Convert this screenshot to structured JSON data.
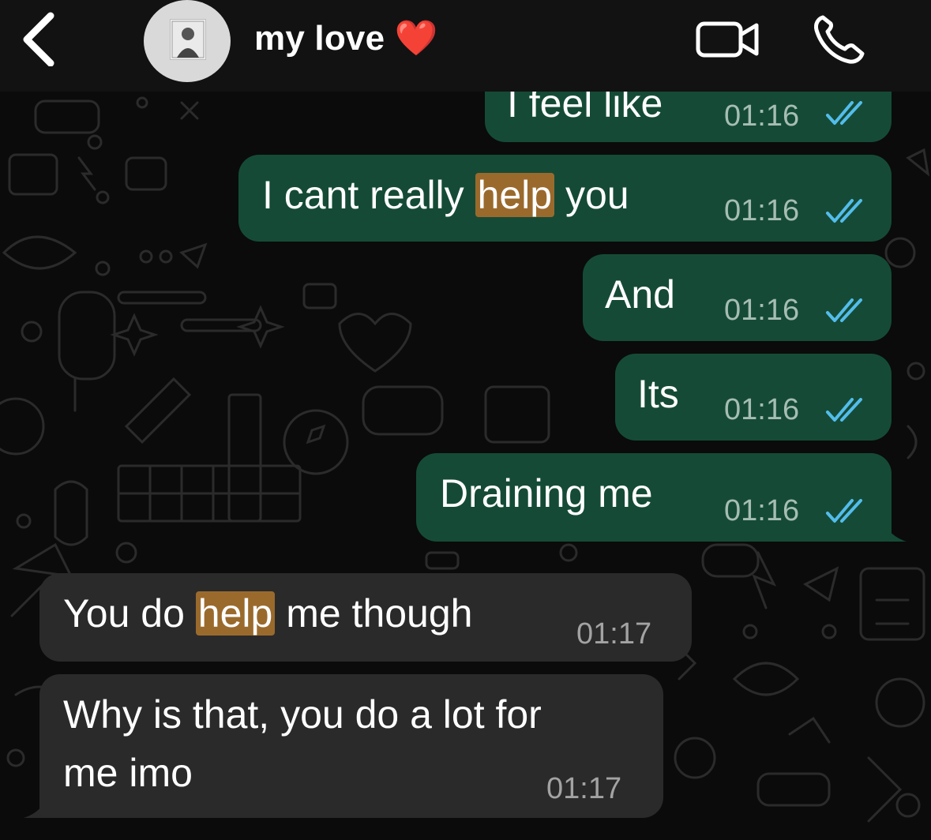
{
  "header": {
    "back_icon": "chevron-left-icon",
    "contact_name": "my love ❤️",
    "video_icon": "video-camera-icon",
    "call_icon": "phone-icon"
  },
  "messages": [
    {
      "direction": "outgoing",
      "text": "I feel like",
      "time": "01:16",
      "status": "read"
    },
    {
      "direction": "outgoing",
      "text_before": "I cant really ",
      "highlight": "help",
      "text_after": " you",
      "time": "01:16",
      "status": "read"
    },
    {
      "direction": "outgoing",
      "text": "And",
      "time": "01:16",
      "status": "read"
    },
    {
      "direction": "outgoing",
      "text": "Its",
      "time": "01:16",
      "status": "read"
    },
    {
      "direction": "outgoing",
      "text": "Draining me",
      "time": "01:16",
      "status": "read"
    },
    {
      "direction": "incoming",
      "text_before": "You do ",
      "highlight": "help",
      "text_after": " me though",
      "time": "01:17"
    },
    {
      "direction": "incoming",
      "text_line1": "Why is that, you do a lot for",
      "text_line2": "me imo",
      "time": "01:17"
    }
  ],
  "colors": {
    "outgoing_bubble": "#154b36",
    "incoming_bubble": "#2a2a2a",
    "highlight": "#9a6a2d",
    "read_ticks": "#53bdeb",
    "background": "#0b0b0b"
  }
}
